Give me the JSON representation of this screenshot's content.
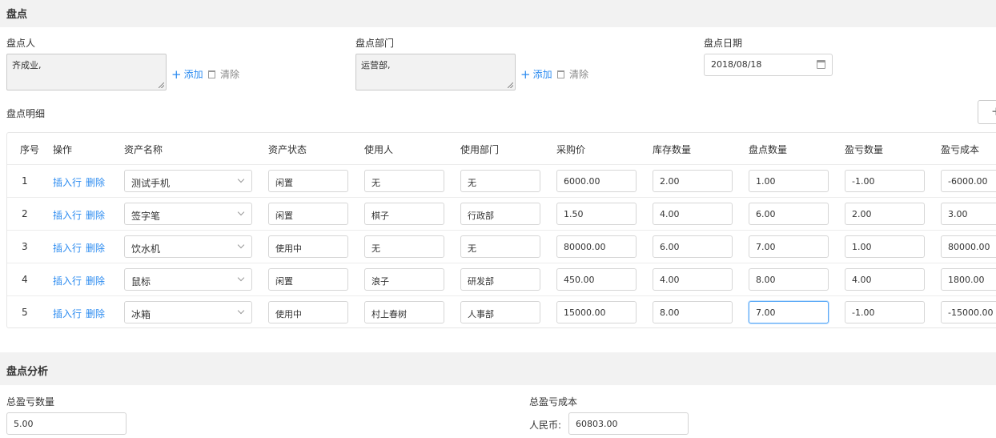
{
  "header": {
    "title": "盘点"
  },
  "form": {
    "person_label": "盘点人",
    "person_value": "齐成业,",
    "dept_label": "盘点部门",
    "dept_value": "运营部,",
    "add_label": "添加",
    "clear_label": "清除",
    "date_label": "盘点日期",
    "date_value": "2018/08/18"
  },
  "detail": {
    "title": "盘点明细",
    "corner_button": "+",
    "columns": [
      "序号",
      "操作",
      "资产名称",
      "资产状态",
      "使用人",
      "使用部门",
      "采购价",
      "库存数量",
      "盘点数量",
      "盈亏数量",
      "盈亏成本"
    ],
    "insert_label": "插入行",
    "delete_label": "删除",
    "rows": [
      [
        "1",
        "测试手机",
        "闲置",
        "无",
        "无",
        "6000.00",
        "2.00",
        "1.00",
        "-1.00",
        "-6000.00"
      ],
      [
        "2",
        "签字笔",
        "闲置",
        "棋子",
        "行政部",
        "1.50",
        "4.00",
        "6.00",
        "2.00",
        "3.00"
      ],
      [
        "3",
        "饮水机",
        "使用中",
        "无",
        "无",
        "80000.00",
        "6.00",
        "7.00",
        "1.00",
        "80000.00"
      ],
      [
        "4",
        "鼠标",
        "闲置",
        "浪子",
        "研发部",
        "450.00",
        "4.00",
        "8.00",
        "4.00",
        "1800.00"
      ],
      [
        "5",
        "冰箱",
        "使用中",
        "村上春树",
        "人事部",
        "15000.00",
        "8.00",
        "7.00",
        "-1.00",
        "-15000.00"
      ]
    ]
  },
  "analysis": {
    "title": "盘点分析",
    "total_qty_label": "总盈亏数量",
    "total_qty_value": "5.00",
    "total_cost_label": "总盈亏成本",
    "currency_label": "人民币:",
    "total_cost_value": "60803.00"
  },
  "colors": {
    "link": "#2d8cf0",
    "header_bg": "#f2f2f2",
    "focus_border": "#5aa9f7"
  }
}
